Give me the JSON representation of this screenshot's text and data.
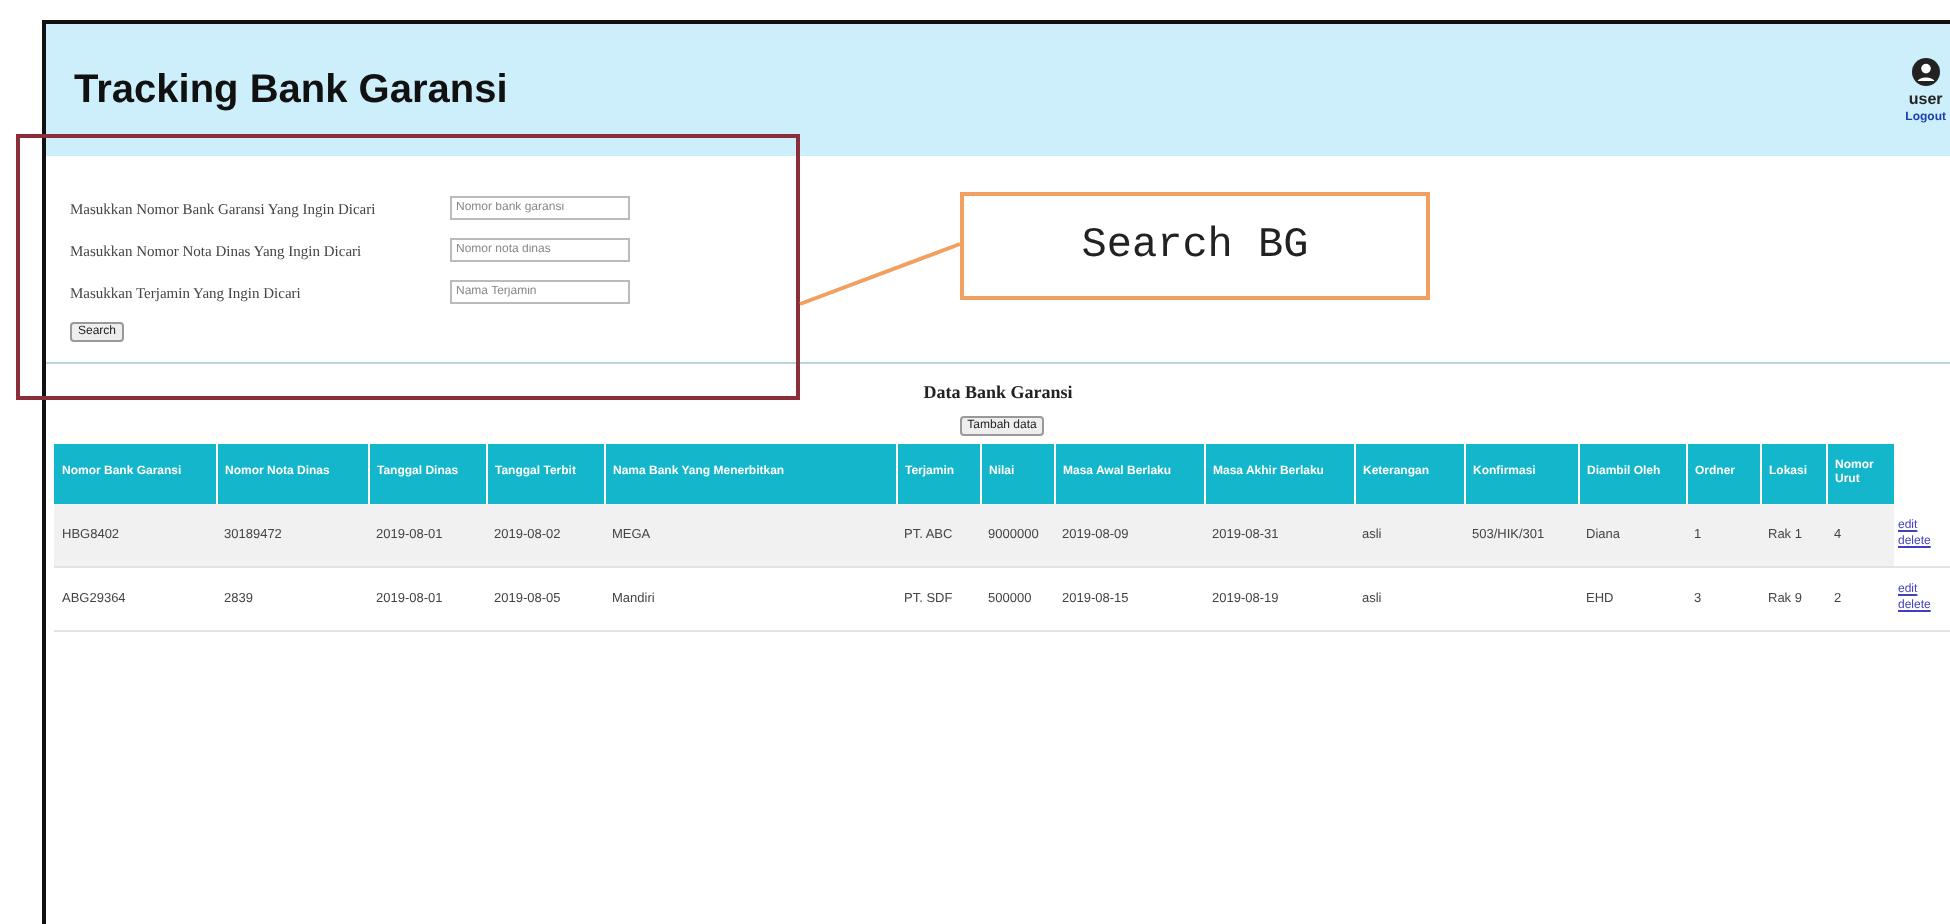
{
  "header": {
    "title": "Tracking Bank Garansi",
    "user": "user",
    "logout": "Logout"
  },
  "search_form": {
    "fields": [
      {
        "label": "Masukkan Nomor Bank Garansi Yang Ingin Dicari",
        "placeholder": "Nomor bank garansi"
      },
      {
        "label": "Masukkan Nomor Nota Dinas Yang Ingin Dicari",
        "placeholder": "Nomor nota dinas"
      },
      {
        "label": "Masukkan Terjamin Yang Ingin Dicari",
        "placeholder": "Nama Terjamin"
      }
    ],
    "button": "Search"
  },
  "annotation": {
    "label": "Search BG"
  },
  "table": {
    "title": "Data Bank Garansi",
    "add_button": "Tambah data",
    "columns": [
      "Nomor Bank Garansi",
      "Nomor Nota Dinas",
      "Tanggal Dinas",
      "Tanggal Terbit",
      "Nama Bank Yang Menerbitkan",
      "Terjamin",
      "Nilai",
      "Masa Awal Berlaku",
      "Masa Akhir Berlaku",
      "Keterangan",
      "Konfirmasi",
      "Diambil Oleh",
      "Ordner",
      "Lokasi",
      "Nomor Urut"
    ],
    "rows": [
      {
        "cells": [
          "HBG8402",
          "30189472",
          "2019-08-01",
          "2019-08-02",
          "MEGA",
          "PT. ABC",
          "9000000",
          "2019-08-09",
          "2019-08-31",
          "asli",
          "503/HIK/301",
          "Diana",
          "1",
          "Rak 1",
          "4"
        ],
        "actions": [
          "edit",
          "delete"
        ]
      },
      {
        "cells": [
          "ABG29364",
          "2839",
          "2019-08-01",
          "2019-08-05",
          "Mandiri",
          "PT. SDF",
          "500000",
          "2019-08-15",
          "2019-08-19",
          "asli",
          null,
          "EHD",
          "3",
          "Rak 9",
          "2"
        ],
        "actions": [
          "edit",
          "delete"
        ]
      }
    ]
  }
}
